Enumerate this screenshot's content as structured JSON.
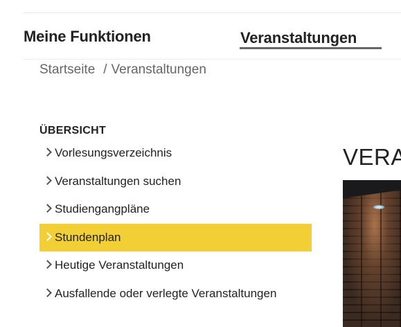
{
  "nav": {
    "primary_label": "Meine Funktionen",
    "active_label": "Veranstaltungen"
  },
  "breadcrumb": {
    "home": "Startseite",
    "separator": "/",
    "current": "Veranstaltungen"
  },
  "sidebar": {
    "heading": "ÜBERSICHT",
    "items": [
      {
        "label": "Vorlesungsverzeichnis",
        "active": false
      },
      {
        "label": "Veranstaltungen suchen",
        "active": false
      },
      {
        "label": "Studiengangpläne",
        "active": false
      },
      {
        "label": "Stundenplan",
        "active": true
      },
      {
        "label": "Heutige Veranstaltungen",
        "active": false
      },
      {
        "label": "Ausfallende oder verlegte Veranstaltungen",
        "active": false
      }
    ]
  },
  "main": {
    "title": "VERA"
  },
  "colors": {
    "active_highlight": "#f2cf34",
    "text": "#222222",
    "muted": "#666666"
  },
  "icons": {
    "menu_item": "chevron-right-icon"
  }
}
